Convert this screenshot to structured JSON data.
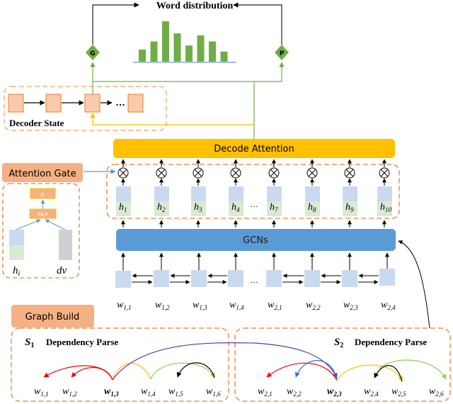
{
  "title": "Word distribution",
  "gates": {
    "generate": "G",
    "pointer": "P"
  },
  "word_distribution": {
    "bar_values": [
      3,
      5,
      10,
      7,
      4,
      6.5,
      5,
      2.5
    ]
  },
  "decoder": {
    "label": "Decoder State",
    "ellipsis": "…"
  },
  "decode_attention": {
    "label": "Decode Attention"
  },
  "attention_gate": {
    "label": "Attention Gate",
    "gate_output": "g",
    "gate_output_sub": "i",
    "mlp": "MLP",
    "input_h": "h",
    "input_h_sub": "i",
    "input_dv": "dv"
  },
  "hidden_states": [
    {
      "main": "h",
      "sub": "1"
    },
    {
      "main": "h",
      "sub": "2"
    },
    {
      "main": "h",
      "sub": "3"
    },
    {
      "main": "h",
      "sub": "4"
    },
    {
      "main": "h",
      "sub": "7"
    },
    {
      "main": "h",
      "sub": "8"
    },
    {
      "main": "h",
      "sub": "9"
    },
    {
      "main": "h",
      "sub": "10"
    }
  ],
  "hidden_ellipsis": "…",
  "gcn": {
    "label": "GCNs"
  },
  "input_ellipsis": "…",
  "input_words": [
    {
      "main": "w",
      "sub": "1,1"
    },
    {
      "main": "w",
      "sub": "1,2"
    },
    {
      "main": "w",
      "sub": "1,3"
    },
    {
      "main": "w",
      "sub": "1,4"
    },
    {
      "main": "w",
      "sub": "2,1"
    },
    {
      "main": "w",
      "sub": "2,2"
    },
    {
      "main": "w",
      "sub": "2,3"
    },
    {
      "main": "w",
      "sub": "2,4"
    }
  ],
  "graph_build": {
    "label": "Graph Build"
  },
  "sentence1": {
    "label_main": "S",
    "label_sub": "1",
    "title": "Dependency Parse",
    "words": [
      {
        "main": "w",
        "sub": "1,1",
        "bold": false
      },
      {
        "main": "w",
        "sub": "1,2",
        "bold": false
      },
      {
        "main": "w",
        "sub": "1,3",
        "bold": true
      },
      {
        "main": "w",
        "sub": "1,4",
        "bold": false
      },
      {
        "main": "w",
        "sub": "1,5",
        "bold": false
      },
      {
        "main": "w",
        "sub": "1,6",
        "bold": false
      }
    ]
  },
  "sentence2": {
    "label_main": "S",
    "label_sub": "2",
    "title": "Dependency Parse",
    "words": [
      {
        "main": "w",
        "sub": "2,1",
        "bold": false
      },
      {
        "main": "w",
        "sub": "2,2",
        "bold": false
      },
      {
        "main": "w",
        "sub": "2,3",
        "bold": true
      },
      {
        "main": "w",
        "sub": "2,4",
        "bold": false
      },
      {
        "main": "w",
        "sub": "2,5",
        "bold": false
      },
      {
        "main": "w",
        "sub": "2,6",
        "bold": false
      }
    ]
  },
  "colors": {
    "green": "#70ad47",
    "orange_dash": "#ed7d31",
    "peach": "#f8cbad",
    "salmon": "#f4b183",
    "yellow": "#ffc000",
    "blue": "#5b9bd5",
    "light_blue": "#c9daf0",
    "light_green": "#d9ead3",
    "gray": "#d0d0d0",
    "red": "#ff0000",
    "purple": "#7030a0",
    "dep_yellow": "#ffc000",
    "dep_green": "#92d050",
    "dep_blue": "#2e75d6"
  }
}
